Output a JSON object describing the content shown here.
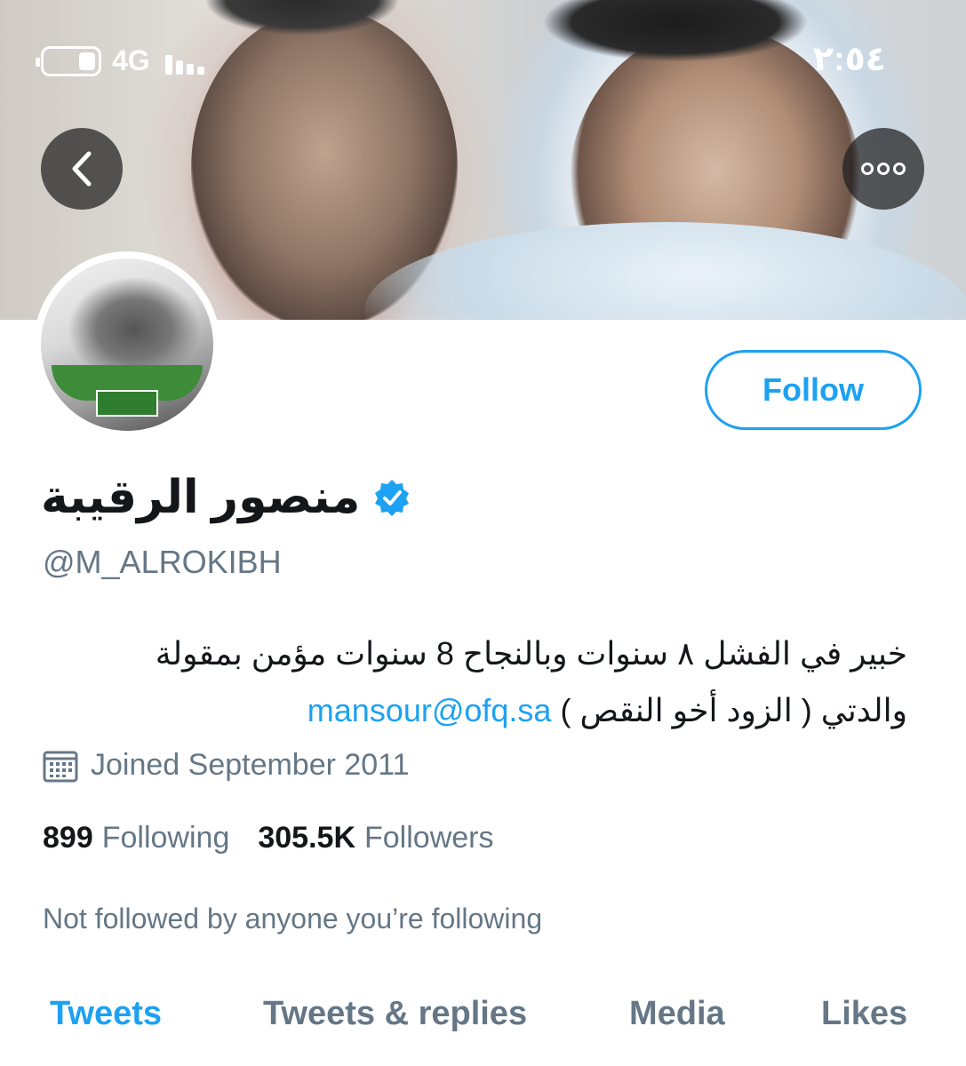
{
  "status_bar": {
    "network": "4G",
    "time": "٢:٥٤"
  },
  "banner": {
    "back_icon": "chevron-left-icon",
    "more_icon": "more-horizontal-icon"
  },
  "profile": {
    "display_name": "منصور الرقيبة",
    "verified": true,
    "handle": "@M_ALROKIBH",
    "bio_line1": "خبير في الفشل ٨ سنوات وبالنجاح 8 سنوات مؤمن بمقولة",
    "bio_line2_text": "والدتي ( الزود أخو النقص ) ",
    "bio_link": "mansour@ofq.sa",
    "joined": "Joined September 2011",
    "following_count": "899",
    "following_label": "Following",
    "followers_count": "305.5K",
    "followers_label": "Followers",
    "not_followed_text": "Not followed by anyone you’re following"
  },
  "actions": {
    "follow_label": "Follow"
  },
  "tabs": [
    {
      "label": "Tweets",
      "active": true
    },
    {
      "label": "Tweets & replies",
      "active": false
    },
    {
      "label": "Media",
      "active": false
    },
    {
      "label": "Likes",
      "active": false
    }
  ],
  "colors": {
    "accent": "#1da1f2",
    "secondary_text": "#657786",
    "primary_text": "#14171a"
  }
}
